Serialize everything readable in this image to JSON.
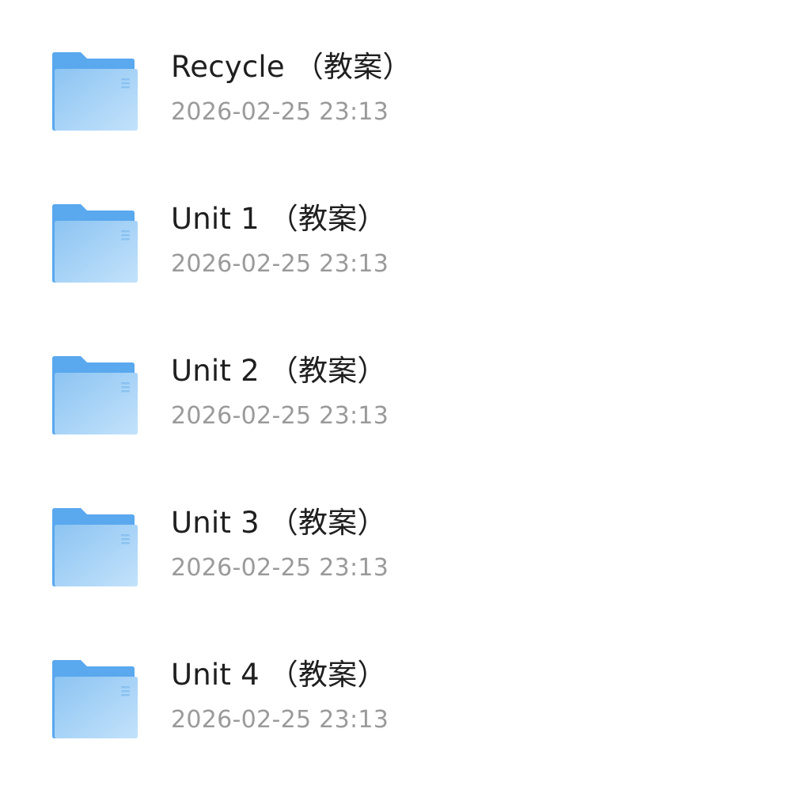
{
  "folders": [
    {
      "name": "Recycle （教案）",
      "date": "2026-02-25 23:13",
      "icon": "folder-icon"
    },
    {
      "name": "Unit 1 （教案）",
      "date": "2026-02-25 23:13",
      "icon": "folder-icon"
    },
    {
      "name": "Unit 2 （教案）",
      "date": "2026-02-25 23:13",
      "icon": "folder-icon"
    },
    {
      "name": "Unit 3 （教案）",
      "date": "2026-02-25 23:13",
      "icon": "folder-icon"
    },
    {
      "name": "Unit 4 （教案）",
      "date": "2026-02-25 23:13",
      "icon": "folder-icon"
    }
  ],
  "colors": {
    "folder_back": "#5aa8ee",
    "folder_front_light": "#b9dcfa",
    "folder_front_dark": "#8cc4f2",
    "name_text": "#1f1f1f",
    "date_text": "#9a9a9a"
  }
}
